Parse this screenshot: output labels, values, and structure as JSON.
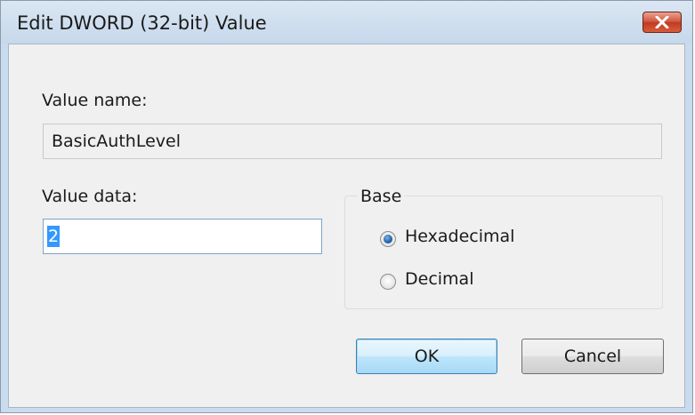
{
  "dialog": {
    "title": "Edit DWORD (32-bit) Value"
  },
  "value_name": {
    "label": "Value name:",
    "value": "BasicAuthLevel"
  },
  "value_data": {
    "label": "Value data:",
    "value": "2"
  },
  "base": {
    "label": "Base",
    "options": [
      {
        "label": "Hexadecimal",
        "checked": true
      },
      {
        "label": "Decimal",
        "checked": false
      }
    ]
  },
  "buttons": {
    "ok": "OK",
    "cancel": "Cancel"
  }
}
